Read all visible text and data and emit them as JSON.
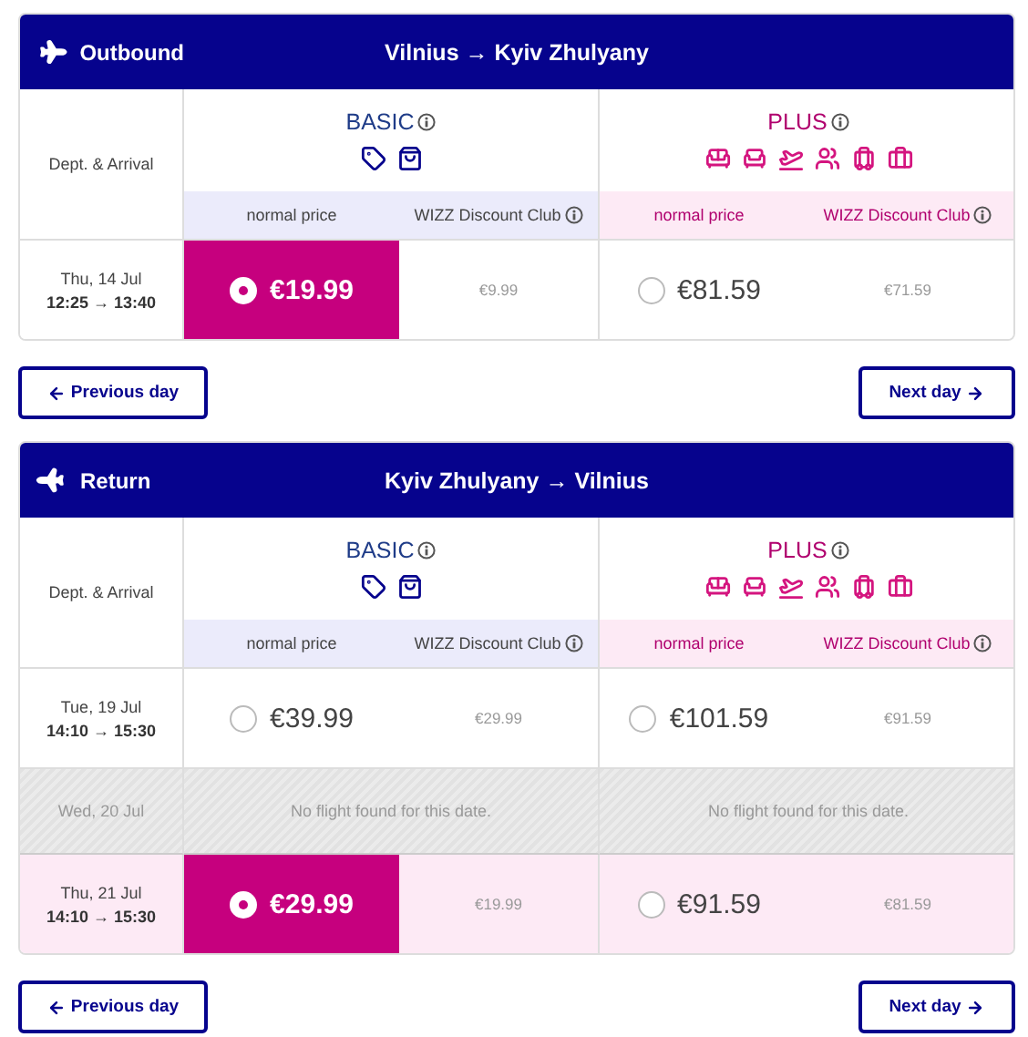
{
  "sections": [
    {
      "kind": "outbound",
      "label": "Outbound",
      "route": "Vilnius → Kyiv Zhulyany",
      "date_heading": "Dept. & Arrival",
      "fares": [
        {
          "kind": "basic",
          "name": "BASIC",
          "normal_label": "normal price",
          "club_label": "WIZZ Discount Club"
        },
        {
          "kind": "plus",
          "name": "PLUS",
          "normal_label": "normal price",
          "club_label": "WIZZ Discount Club"
        }
      ],
      "rows": [
        {
          "kind": "flight",
          "date": "Thu, 14 Jul",
          "times": "12:25 → 13:40",
          "highlighted": false,
          "cells": [
            {
              "price": "€19.99",
              "club": "€9.99",
              "selected": true
            },
            {
              "price": "€81.59",
              "club": "€71.59",
              "selected": false
            }
          ]
        }
      ],
      "prev": "Previous day",
      "next": "Next day"
    },
    {
      "kind": "return",
      "label": "Return",
      "route": "Kyiv Zhulyany → Vilnius",
      "date_heading": "Dept. & Arrival",
      "fares": [
        {
          "kind": "basic",
          "name": "BASIC",
          "normal_label": "normal price",
          "club_label": "WIZZ Discount Club"
        },
        {
          "kind": "plus",
          "name": "PLUS",
          "normal_label": "normal price",
          "club_label": "WIZZ Discount Club"
        }
      ],
      "rows": [
        {
          "kind": "flight",
          "date": "Tue, 19 Jul",
          "times": "14:10 → 15:30",
          "highlighted": false,
          "cells": [
            {
              "price": "€39.99",
              "club": "€29.99",
              "selected": false
            },
            {
              "price": "€101.59",
              "club": "€91.59",
              "selected": false
            }
          ]
        },
        {
          "kind": "none",
          "date": "Wed, 20 Jul",
          "messages": [
            "No flight found for this date.",
            "No flight found for this date."
          ]
        },
        {
          "kind": "flight",
          "date": "Thu, 21 Jul",
          "times": "14:10 → 15:30",
          "highlighted": true,
          "cells": [
            {
              "price": "€29.99",
              "club": "€19.99",
              "selected": true
            },
            {
              "price": "€91.59",
              "club": "€81.59",
              "selected": false
            }
          ]
        }
      ],
      "prev": "Previous day",
      "next": "Next day"
    }
  ]
}
